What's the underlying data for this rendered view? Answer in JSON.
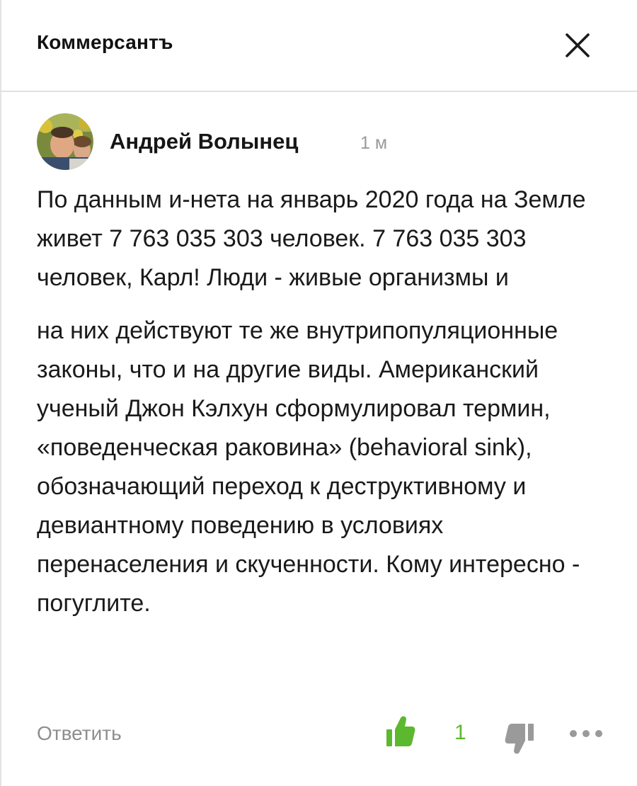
{
  "header": {
    "title": "Коммерсантъ",
    "close_icon": "close-icon"
  },
  "comment": {
    "author": "Андрей Волынец",
    "time_ago": "1 м",
    "paragraphs": [
      "По данным и-нета на январь 2020 года на Земле живет 7 763 035 303 человек. 7 763 035 303 человек, Карл! Люди - живые организмы и",
      "на них действуют те же внутрипопуляционные законы, что и на другие виды. Американский ученый Джон Кэлхун сформулировал термин, «поведенческая раковина» (behavioral sink), обозначающий переход к деструктивному и девиантному поведению в условиях перенаселения и скученности. Кому интересно - погуглите."
    ]
  },
  "actions": {
    "reply_label": "Ответить",
    "like_count": "1",
    "like_icon": "thumbs-up-icon",
    "dislike_icon": "thumbs-down-icon",
    "more_icon": "more-dots-icon"
  },
  "colors": {
    "like_green": "#5cb82e",
    "muted_gray": "#8e8e8e",
    "text_dark": "#1a1a1a"
  }
}
